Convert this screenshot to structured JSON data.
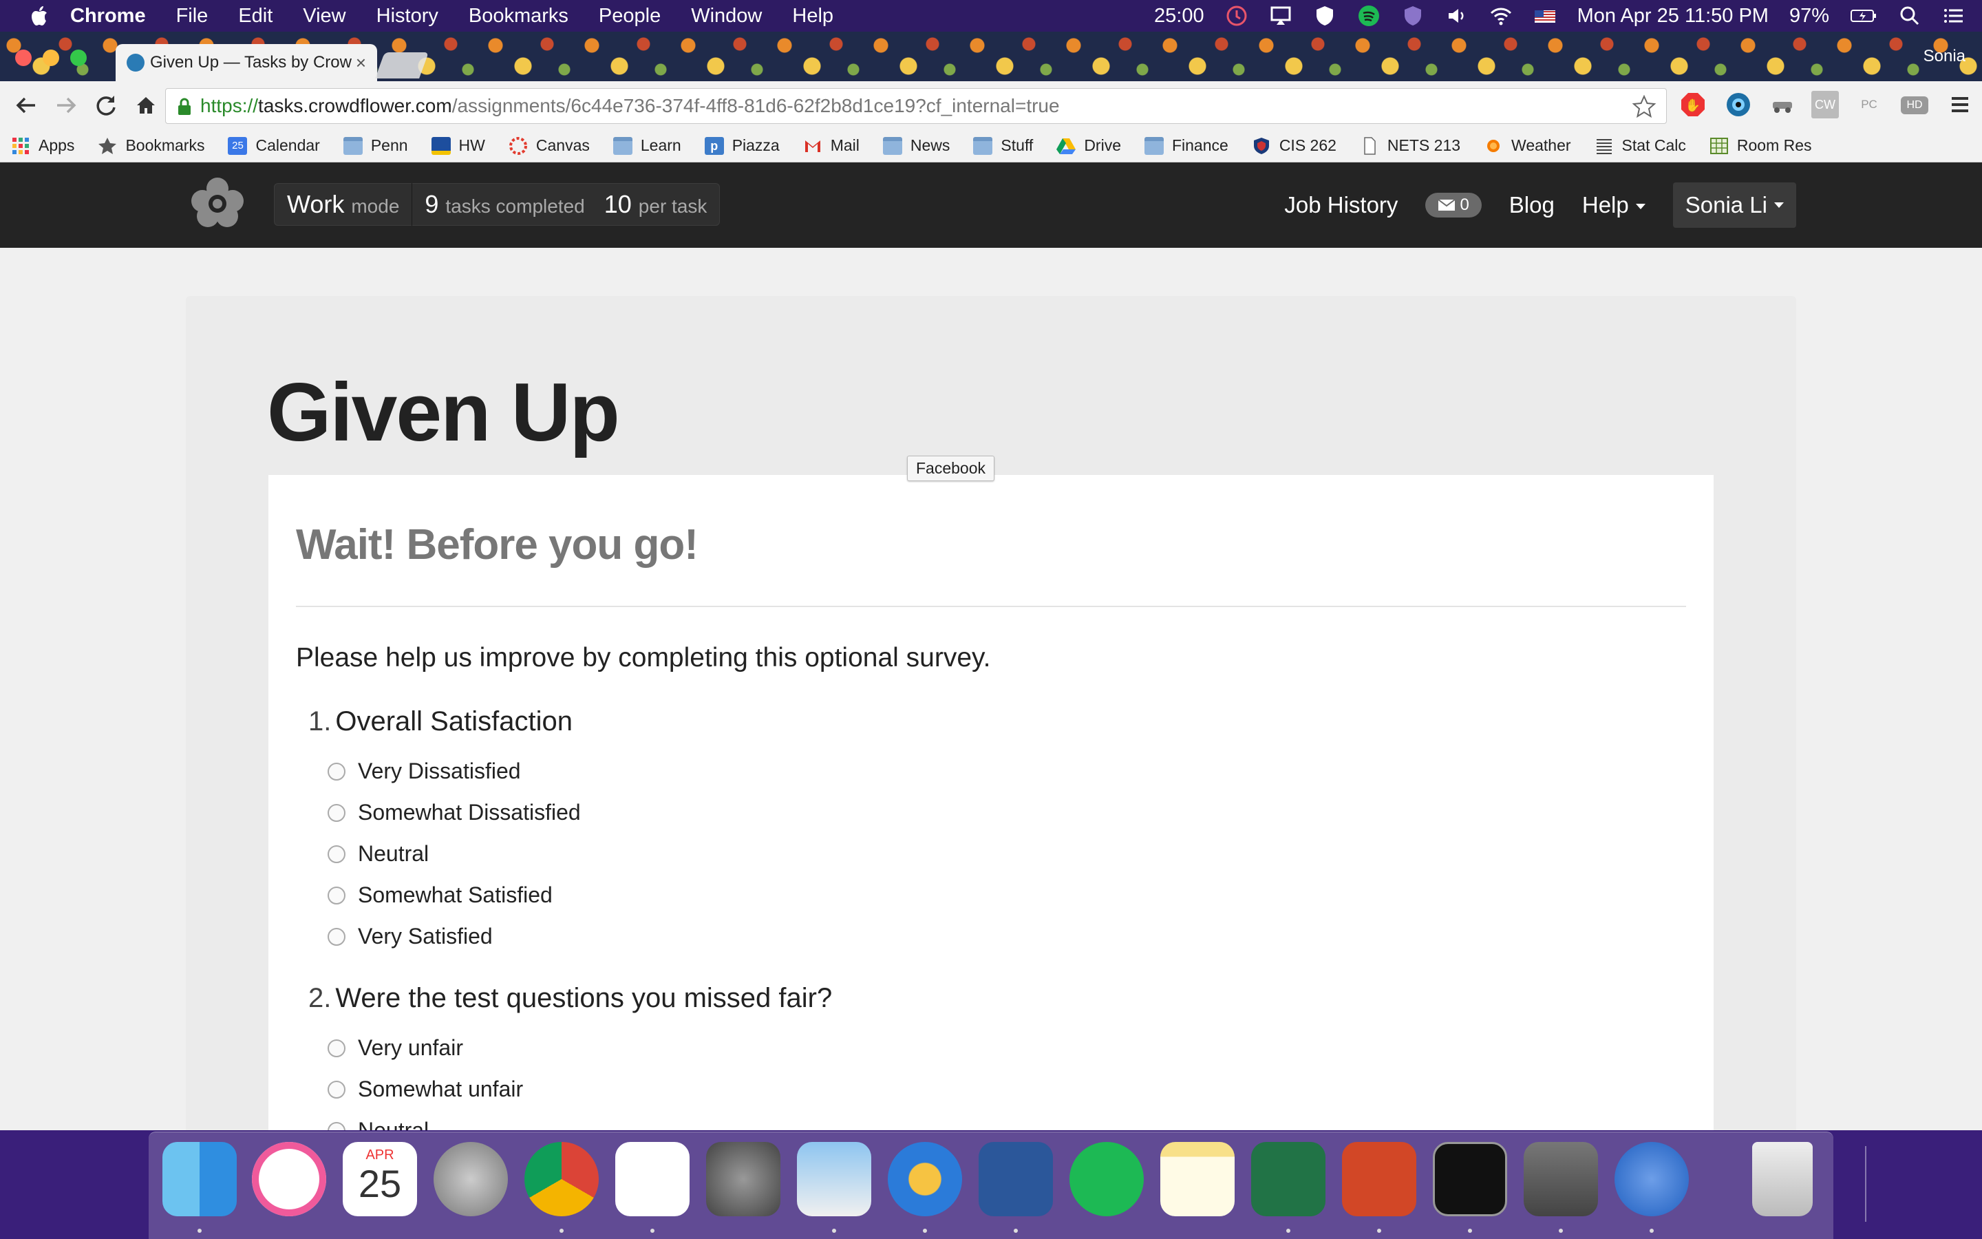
{
  "menubar": {
    "app": "Chrome",
    "items": [
      "File",
      "Edit",
      "View",
      "History",
      "Bookmarks",
      "People",
      "Window",
      "Help"
    ],
    "timer": "25:00",
    "datetime": "Mon Apr 25  11:50 PM",
    "battery": "97%"
  },
  "browser": {
    "tab_title": "Given Up — Tasks by Crow",
    "tab_close": "×",
    "profile_name": "Sonia",
    "url_scheme": "https://",
    "url_host": "tasks.crowdflower.com",
    "url_path": "/assignments/6c44e736-374f-4ff8-81d6-62f2b8d1ce19?cf_internal=true",
    "extensions": [
      "adblock-icon",
      "eye-icon",
      "car-icon",
      "cw-icon",
      "pc-icon",
      "hd-icon",
      "menu-icon"
    ],
    "ext_labels": {
      "cw": "CW",
      "pc": "PC",
      "hd": "HD"
    }
  },
  "bookmarks": [
    {
      "label": "Apps",
      "icon": "apps-grid-icon"
    },
    {
      "label": "Bookmarks",
      "icon": "star-icon"
    },
    {
      "label": "Calendar",
      "icon": "calendar-icon"
    },
    {
      "label": "Penn",
      "icon": "folder-icon"
    },
    {
      "label": "HW",
      "icon": "hw-icon"
    },
    {
      "label": "Canvas",
      "icon": "canvas-icon"
    },
    {
      "label": "Learn",
      "icon": "folder-icon"
    },
    {
      "label": "Piazza",
      "icon": "piazza-icon"
    },
    {
      "label": "Mail",
      "icon": "gmail-icon"
    },
    {
      "label": "News",
      "icon": "folder-icon"
    },
    {
      "label": "Stuff",
      "icon": "folder-icon"
    },
    {
      "label": "Drive",
      "icon": "drive-icon"
    },
    {
      "label": "Finance",
      "icon": "folder-icon"
    },
    {
      "label": "CIS 262",
      "icon": "shield-icon"
    },
    {
      "label": "NETS 213",
      "icon": "document-icon"
    },
    {
      "label": "Weather",
      "icon": "weather-icon"
    },
    {
      "label": "Stat Calc",
      "icon": "table-icon"
    },
    {
      "label": "Room Res",
      "icon": "calendar-grid-icon"
    }
  ],
  "navbar": {
    "mode_big": "Work",
    "mode_small": "mode",
    "tasks_big": "9",
    "tasks_small": "tasks completed",
    "per_big": "10",
    "per_small": "per task",
    "job_history": "Job History",
    "messages_count": "0",
    "blog": "Blog",
    "help": "Help",
    "user": "Sonia Li"
  },
  "job": {
    "title": "Given Up",
    "tooltip": "Facebook"
  },
  "survey": {
    "heading": "Wait! Before you go!",
    "intro": "Please help us improve by completing this optional survey.",
    "questions": [
      {
        "number": "1.",
        "text": "Overall Satisfaction",
        "options": [
          "Very Dissatisfied",
          "Somewhat Dissatisfied",
          "Neutral",
          "Somewhat Satisfied",
          "Very Satisfied"
        ]
      },
      {
        "number": "2.",
        "text": "Were the test questions you missed fair?",
        "options": [
          "Very unfair",
          "Somewhat unfair",
          "Neutral"
        ]
      }
    ]
  },
  "dock": {
    "calendar_month": "APR",
    "calendar_day": "25",
    "apps": [
      "finder-icon",
      "itunes-icon",
      "calendar-icon",
      "launchpad-icon",
      "chrome-icon",
      "reminders-icon",
      "system-preferences-icon",
      "preview-icon",
      "pages-pen-icon",
      "word-icon",
      "spotify-icon",
      "notes-icon",
      "excel-icon",
      "powerpoint-icon",
      "terminal-icon",
      "sublime-icon",
      "r-icon",
      "trash-icon"
    ]
  }
}
